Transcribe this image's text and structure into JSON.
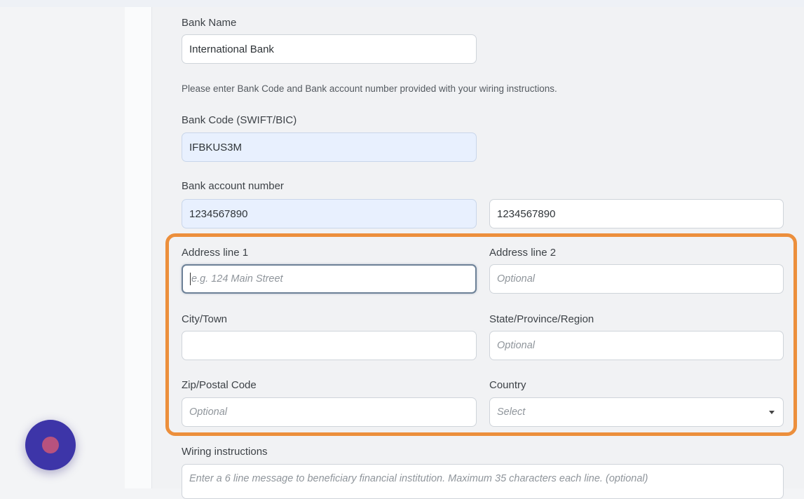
{
  "form": {
    "bank_name": {
      "label": "Bank Name",
      "value": "International Bank"
    },
    "instructions_note": "Please enter Bank Code and Bank account number provided with your wiring instructions.",
    "bank_code": {
      "label": "Bank Code (SWIFT/BIC)",
      "value": "IFBKUS3M"
    },
    "account_number": {
      "label": "Bank account number",
      "value": "1234567890",
      "confirm_value": "1234567890"
    },
    "address_line_1": {
      "label": "Address line 1",
      "placeholder": "e.g. 124 Main Street"
    },
    "address_line_2": {
      "label": "Address line 2",
      "placeholder": "Optional"
    },
    "city": {
      "label": "City/Town",
      "placeholder": ""
    },
    "state": {
      "label": "State/Province/Region",
      "placeholder": "Optional"
    },
    "zip": {
      "label": "Zip/Postal Code",
      "placeholder": "Optional"
    },
    "country": {
      "label": "Country",
      "selected": "Select"
    },
    "wiring": {
      "label": "Wiring instructions",
      "placeholder": "Enter a 6 line message to beneficiary financial institution. Maximum 35 characters each line. (optional)"
    }
  },
  "colors": {
    "highlight": "#ec8f3c",
    "fab": "#3d35a8",
    "fab_dot": "#b8527e",
    "autofill": "#e8f0fe"
  },
  "icons": {
    "country_select": "caret-down-icon"
  }
}
